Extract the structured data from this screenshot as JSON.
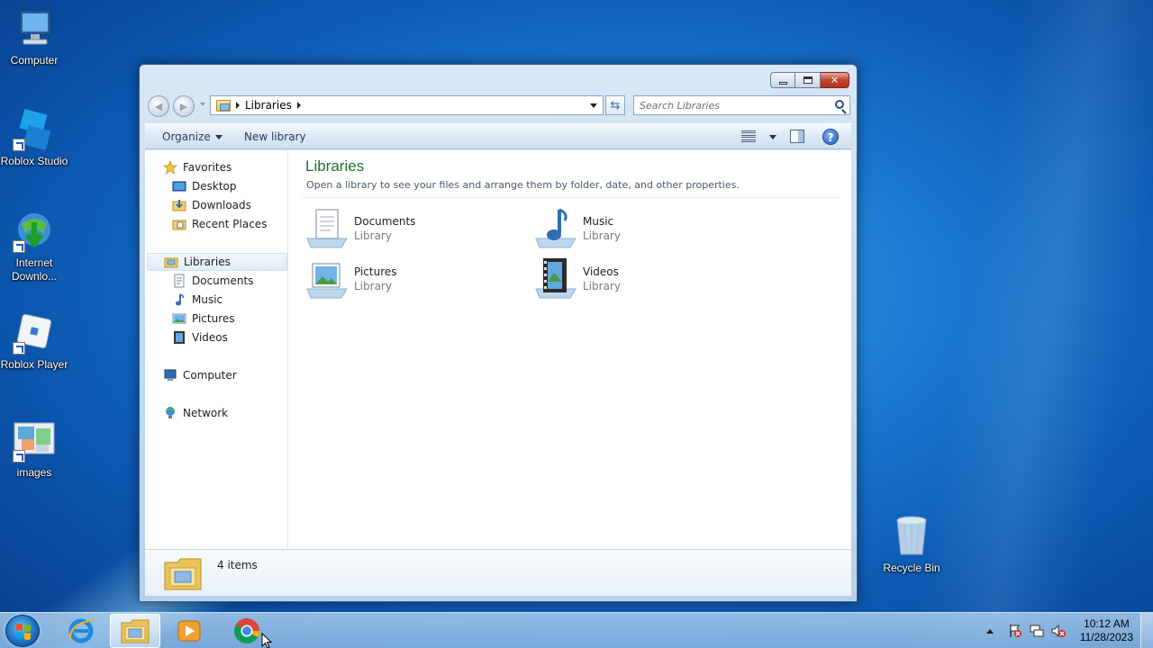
{
  "desktop": {
    "icons": [
      {
        "label": "Computer"
      },
      {
        "label": "Roblox Studio"
      },
      {
        "label": "Internet Downlo..."
      },
      {
        "label": "Roblox Player"
      },
      {
        "label": "images"
      },
      {
        "label": "Recycle Bin"
      }
    ]
  },
  "window": {
    "address": {
      "breadcrumb": "Libraries"
    },
    "search": {
      "placeholder": "Search Libraries"
    },
    "commands": {
      "organize": "Organize",
      "new_library": "New library"
    },
    "navpane": {
      "favorites": {
        "label": "Favorites",
        "items": [
          "Desktop",
          "Downloads",
          "Recent Places"
        ]
      },
      "libraries": {
        "label": "Libraries",
        "items": [
          "Documents",
          "Music",
          "Pictures",
          "Videos"
        ]
      },
      "computer": {
        "label": "Computer"
      },
      "network": {
        "label": "Network"
      }
    },
    "content": {
      "title": "Libraries",
      "subtitle": "Open a library to see your files and arrange them by folder, date, and other properties.",
      "libraries": [
        {
          "name": "Documents",
          "type": "Library",
          "icon": "documents-library-icon"
        },
        {
          "name": "Music",
          "type": "Library",
          "icon": "music-library-icon"
        },
        {
          "name": "Pictures",
          "type": "Library",
          "icon": "pictures-library-icon"
        },
        {
          "name": "Videos",
          "type": "Library",
          "icon": "videos-library-icon"
        }
      ]
    },
    "details": {
      "count": "4 items"
    }
  },
  "taskbar": {
    "pinned": [
      "internet-explorer-icon",
      "windows-explorer-icon",
      "media-player-icon",
      "chrome-icon"
    ],
    "clock": {
      "time": "10:12 AM",
      "date": "11/28/2023"
    }
  },
  "colors": {
    "title_green": "#1e6e2d",
    "accent_blue": "#1d6fc2"
  }
}
